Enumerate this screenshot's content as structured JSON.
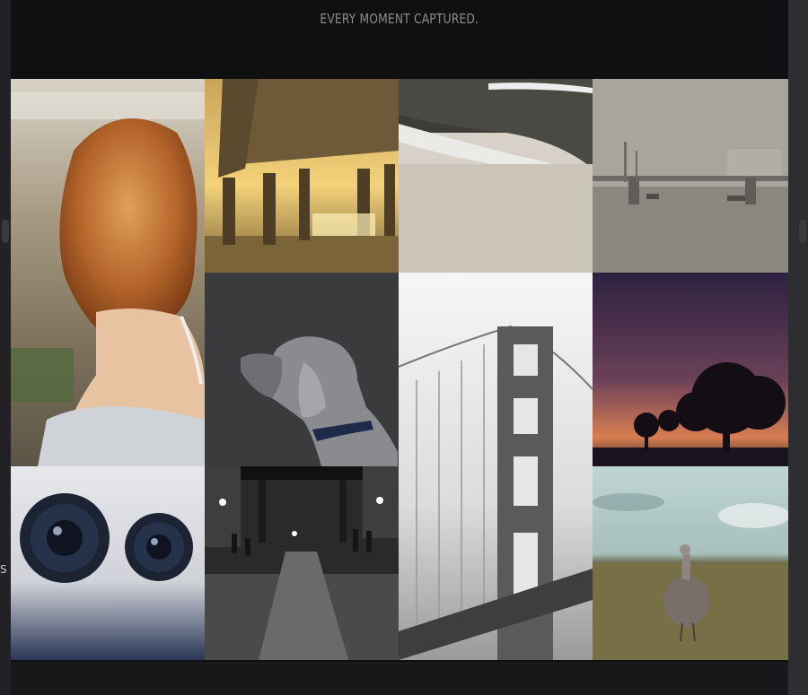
{
  "header": {
    "tagline": "EVERY MOMENT CAPTURED."
  },
  "gallery": {
    "tiles": [
      {
        "icon": "photo-woman-curly-hair"
      },
      {
        "icon": "photo-pier-sunset"
      },
      {
        "icon": "photo-beach-waves"
      },
      {
        "icon": "photo-foggy-harbor-bridge"
      },
      {
        "icon": "photo-dog-silhouette"
      },
      {
        "icon": "photo-golden-gate-bridge"
      },
      {
        "icon": "photo-purple-sunset-trees"
      },
      {
        "icon": "photo-camera-lenses"
      },
      {
        "icon": "photo-rainy-street-night"
      },
      {
        "icon": "photo-bird-in-field"
      }
    ]
  },
  "edge": {
    "left_fragment": "S"
  },
  "colors": {
    "background": "#101012",
    "tagline": "#8c8c8c"
  }
}
